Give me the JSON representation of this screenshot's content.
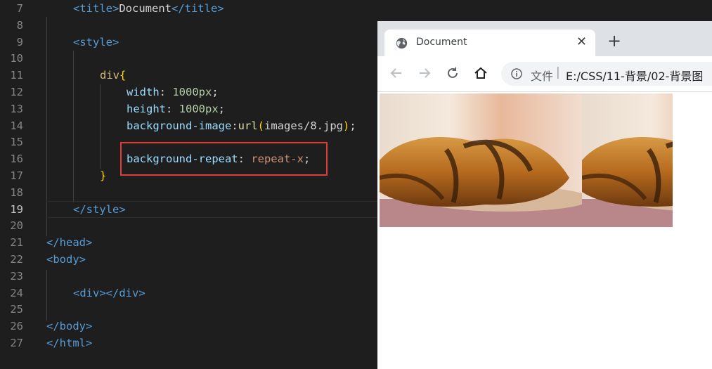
{
  "editor": {
    "lines": [
      {
        "n": "7",
        "parts": [
          [
            "tag",
            "<title>"
          ],
          [
            "txt",
            "Document"
          ],
          [
            "tag",
            "</title>"
          ]
        ]
      },
      {
        "n": "8",
        "parts": []
      },
      {
        "n": "9",
        "parts": [
          [
            "tag",
            "<style>"
          ]
        ]
      },
      {
        "n": "10",
        "parts": []
      },
      {
        "n": "11",
        "parts": [
          [
            "sel",
            "div"
          ],
          [
            "brace",
            "{"
          ]
        ]
      },
      {
        "n": "12",
        "parts": [
          [
            "prop",
            "width"
          ],
          [
            "txt",
            ": "
          ],
          [
            "num",
            "1000px"
          ],
          [
            "txt",
            ";"
          ]
        ]
      },
      {
        "n": "13",
        "parts": [
          [
            "prop",
            "height"
          ],
          [
            "txt",
            ": "
          ],
          [
            "num",
            "1000px"
          ],
          [
            "txt",
            ";"
          ]
        ]
      },
      {
        "n": "14",
        "parts": [
          [
            "prop",
            "background-image"
          ],
          [
            "txt",
            ":"
          ],
          [
            "fn",
            "url"
          ],
          [
            "brace",
            "("
          ],
          [
            "txt",
            "images/8.jpg"
          ],
          [
            "brace",
            ")"
          ],
          [
            "txt",
            ";"
          ]
        ]
      },
      {
        "n": "15",
        "parts": []
      },
      {
        "n": "16",
        "parts": [
          [
            "prop",
            "background-repeat"
          ],
          [
            "txt",
            ": "
          ],
          [
            "val",
            "repeat-x"
          ],
          [
            "txt",
            ";"
          ]
        ]
      },
      {
        "n": "17",
        "parts": [
          [
            "brace",
            "}"
          ]
        ]
      },
      {
        "n": "18",
        "parts": []
      },
      {
        "n": "19",
        "parts": [
          [
            "tag",
            "</style>"
          ]
        ]
      },
      {
        "n": "20",
        "parts": []
      },
      {
        "n": "21",
        "parts": [
          [
            "tag",
            "</head>"
          ]
        ]
      },
      {
        "n": "22",
        "parts": [
          [
            "tag",
            "<body>"
          ]
        ]
      },
      {
        "n": "23",
        "parts": []
      },
      {
        "n": "24",
        "parts": [
          [
            "tag",
            "<div></div>"
          ]
        ]
      },
      {
        "n": "25",
        "parts": []
      },
      {
        "n": "26",
        "parts": [
          [
            "tag",
            "</body>"
          ]
        ]
      },
      {
        "n": "27",
        "parts": [
          [
            "tag",
            "</html>"
          ]
        ]
      }
    ],
    "current_line": "19",
    "highlight_color": "#e03c3c"
  },
  "browser": {
    "tab_title": "Document",
    "tab_icon": "globe-icon",
    "close_glyph": "✕",
    "new_tab_glyph": "+",
    "url_scheme": "文件",
    "url_separator": "|",
    "url_path": "E:/CSS/11-背景/02-背景图",
    "nav_icons": [
      "back-arrow-icon",
      "forward-arrow-icon",
      "reload-icon",
      "home-icon"
    ],
    "content_image": "croissant-photo"
  }
}
